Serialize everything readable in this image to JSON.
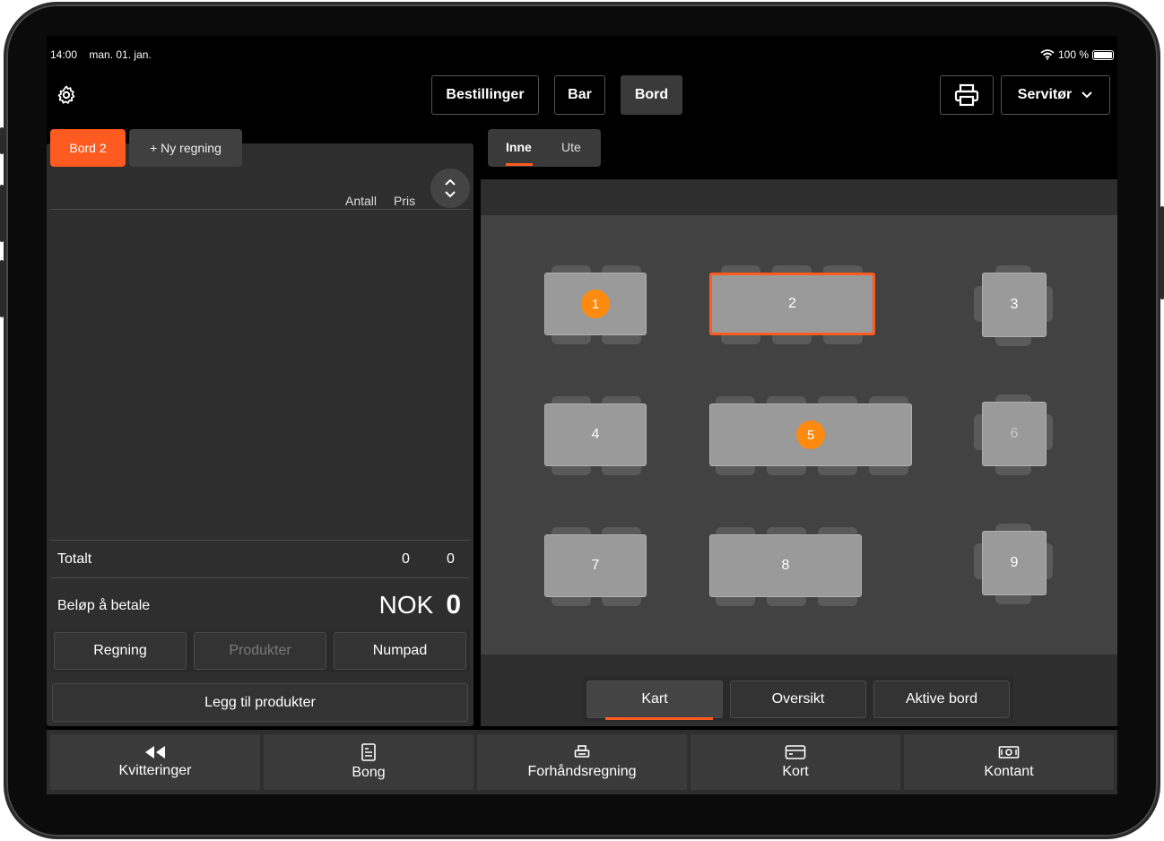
{
  "status": {
    "time": "14:00",
    "date": "man. 01. jan.",
    "battery": "100 %"
  },
  "topbar": {
    "nav": [
      "Bestillinger",
      "Bar",
      "Bord"
    ],
    "active_nav": "Bord",
    "user_menu": "Servitør"
  },
  "bill": {
    "tabs": {
      "active": "Bord 2",
      "new": "+ Ny regning"
    },
    "columns": {
      "qty": "Antall",
      "price": "Pris"
    },
    "total_label": "Totalt",
    "total_qty": "0",
    "total_price": "0",
    "pay_label": "Beløp å betale",
    "currency": "NOK",
    "amount": "0",
    "modes": [
      "Regning",
      "Produkter",
      "Numpad"
    ],
    "disabled_mode": "Produkter",
    "add_products": "Legg til produkter"
  },
  "rooms": {
    "tabs": [
      "Inne",
      "Ute"
    ],
    "active": "Inne"
  },
  "tables": [
    {
      "id": "1",
      "badge": true
    },
    {
      "id": "2",
      "selected": true
    },
    {
      "id": "3"
    },
    {
      "id": "4"
    },
    {
      "id": "5",
      "badge": true
    },
    {
      "id": "6",
      "dim": true
    },
    {
      "id": "7"
    },
    {
      "id": "8"
    },
    {
      "id": "9"
    }
  ],
  "views": {
    "tabs": [
      "Kart",
      "Oversikt",
      "Aktive bord"
    ],
    "active": "Kart"
  },
  "actions": [
    {
      "label": "Kvitteringer",
      "icon": "rewind-icon"
    },
    {
      "label": "Bong",
      "icon": "receipt-icon"
    },
    {
      "label": "Forhåndsregning",
      "icon": "printer-icon"
    },
    {
      "label": "Kort",
      "icon": "credit-card-icon"
    },
    {
      "label": "Kontant",
      "icon": "cash-icon"
    }
  ],
  "colors": {
    "accent": "#ff5a1f",
    "badge": "#ff8a10",
    "panel": "#2e2e2e",
    "floor": "#424242",
    "table": "#9a9a9a"
  }
}
